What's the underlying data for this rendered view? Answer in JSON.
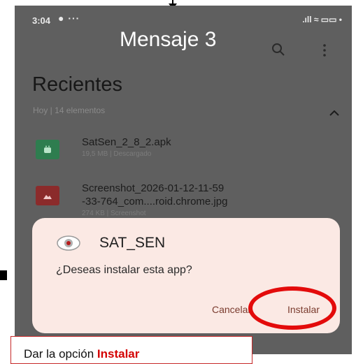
{
  "status_bar": {
    "time": "3:04",
    "dots": "● ···",
    "right": ".ıll ≈ ▭▭ •"
  },
  "overlay": {
    "title": "Mensaje 3",
    "callout_prefix": "Dar la opción ",
    "callout_emphasis": "Instalar",
    "highlight_color": "#e30b0b"
  },
  "header": {
    "title": "Recientes",
    "subtitle": "Hoy | 14 elementos"
  },
  "files": [
    {
      "name_lines": [
        "SatSen_2_8_2.apk"
      ],
      "meta": "19,5 MB | Descargado",
      "color": "#2e7d4f"
    },
    {
      "name_lines": [
        "Screenshot_2026-01-12-11-59",
        "-33-764_com....roid.chrome.jpg"
      ],
      "meta": "274 KB | Screenshot",
      "color": "#8b2b2b"
    }
  ],
  "dialog": {
    "app_name": "SAT_SEN",
    "question": "¿Deseas instalar esta app?",
    "cancel_label": "Cancelar",
    "install_label": "Instalar"
  }
}
